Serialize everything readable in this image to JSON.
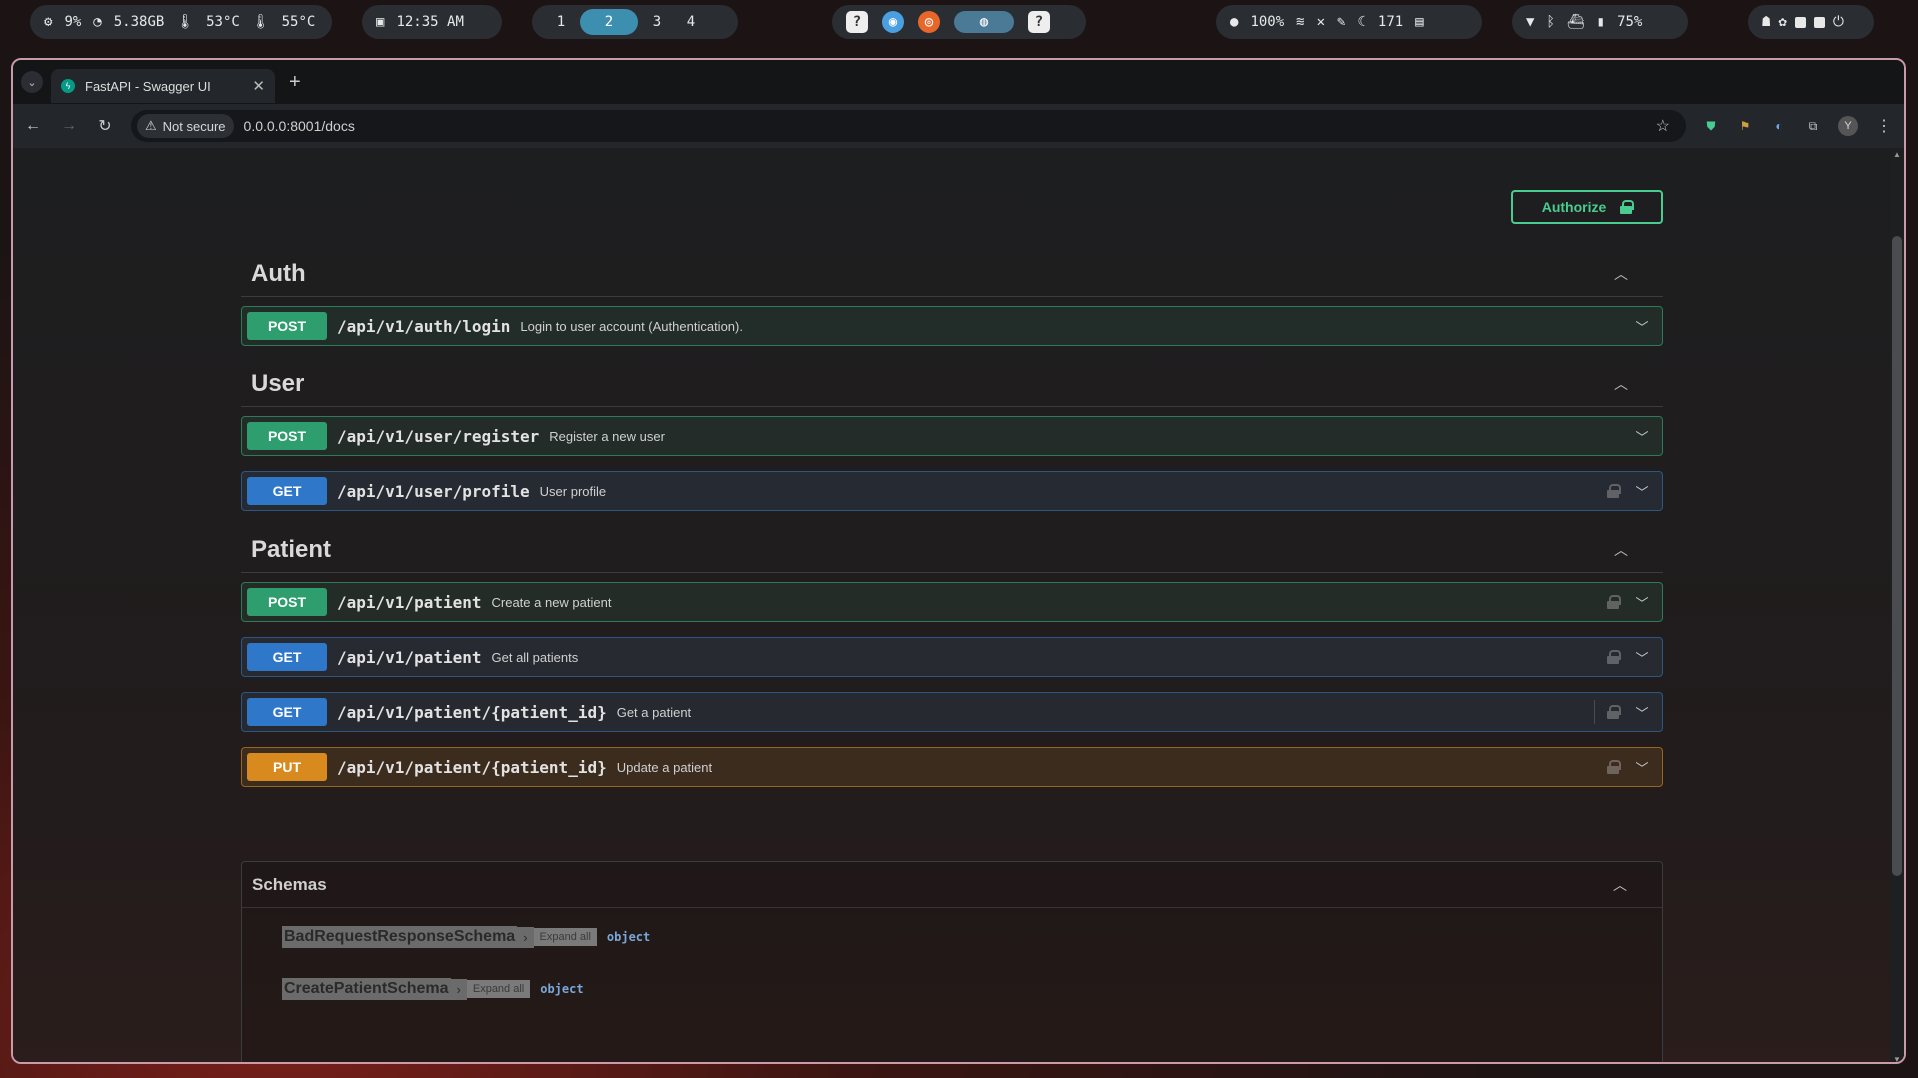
{
  "system_bar": {
    "cpu": "9%",
    "ram": "5.38GB",
    "temp1": "53°C",
    "temp2": "55°C",
    "clock": "12:35 AM",
    "workspaces": [
      "1",
      "2",
      "3",
      "4"
    ],
    "active_workspace": "2",
    "volume": "100%",
    "brightness": "171",
    "battery": "75%"
  },
  "browser": {
    "tab_title": "FastAPI - Swagger UI",
    "security_label": "Not secure",
    "url": "0.0.0.0:8001/docs",
    "profile_initial": "Y"
  },
  "swagger": {
    "authorize_label": "Authorize",
    "tags": [
      {
        "name": "Auth"
      },
      {
        "name": "User"
      },
      {
        "name": "Patient"
      }
    ],
    "operations": [
      {
        "method": "POST",
        "path": "/api/v1/auth/login",
        "summary": "Login to user account (Authentication)."
      },
      {
        "method": "POST",
        "path": "/api/v1/user/register",
        "summary": "Register a new user"
      },
      {
        "method": "GET",
        "path": "/api/v1/user/profile",
        "summary": "User profile"
      },
      {
        "method": "POST",
        "path": "/api/v1/patient",
        "summary": "Create a new patient"
      },
      {
        "method": "GET",
        "path": "/api/v1/patient",
        "summary": "Get all patients"
      },
      {
        "method": "GET",
        "path": "/api/v1/patient/{patient_id}",
        "summary": "Get a patient"
      },
      {
        "method": "PUT",
        "path": "/api/v1/patient/{patient_id}",
        "summary": "Update a patient"
      }
    ],
    "schemas_title": "Schemas",
    "schemas": [
      {
        "name": "BadRequestResponseSchema",
        "expand": "Expand all",
        "type": "object"
      },
      {
        "name": "CreatePatientSchema",
        "expand": "Expand all",
        "type": "object"
      }
    ]
  },
  "colors": {
    "post": "#49cc90",
    "get": "#61affe",
    "put": "#fca130",
    "accent": "#3d8fb0"
  }
}
